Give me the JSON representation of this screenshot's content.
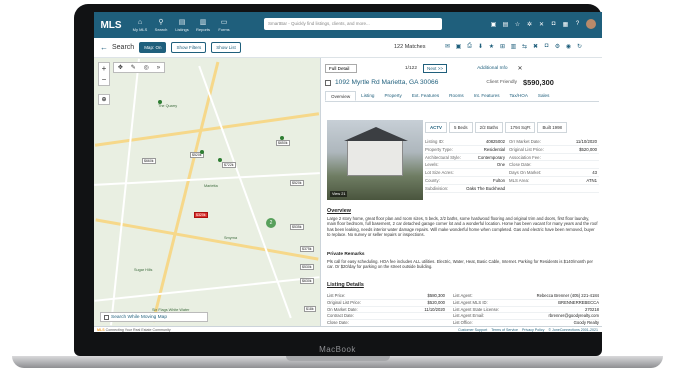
{
  "device": {
    "label": "MacBook"
  },
  "nav": {
    "logo_text": "MLS",
    "items": [
      {
        "label": "My MLS",
        "icon": "home-icon"
      },
      {
        "label": "Search",
        "icon": "search-icon"
      },
      {
        "label": "Listings",
        "icon": "listings-icon"
      },
      {
        "label": "Reports",
        "icon": "reports-icon"
      },
      {
        "label": "Forms",
        "icon": "forms-icon"
      }
    ],
    "smartbar_placeholder": "SmartBar - Quickly find listings, clients, and more..."
  },
  "search": {
    "title": "Search",
    "map_on_label": "Map: On",
    "show_filters_label": "Show Filters",
    "show_list_label": "Show List",
    "matches": "122 Matches"
  },
  "map": {
    "search_while_moving_label": "Search While Moving Map",
    "price_pins": [
      {
        "label": "$660k"
      },
      {
        "label": "$520k"
      },
      {
        "label": "$722k"
      },
      {
        "label": "$650k"
      },
      {
        "label": "$520k"
      },
      {
        "label": "$320k"
      },
      {
        "label": "$535k"
      },
      {
        "label": "$375k"
      },
      {
        "label": "$530k"
      },
      {
        "label": "$630k"
      },
      {
        "label": "$18k"
      }
    ],
    "cluster_label": "2",
    "places": [
      "The Quarry",
      "Marietta",
      "Smyrna",
      "Sugar Hills",
      "Six Flags White Water"
    ]
  },
  "detail": {
    "view_select": "Full Detail",
    "pager": "1/122",
    "next_label": "Next >>",
    "additional_info": "Additional Info",
    "address": "1092 Myrtle Rd Marietta, GA 30066",
    "client_friendly": "Client Friendly",
    "price": "$590,300",
    "tabs": [
      "Overview",
      "Listing",
      "Property",
      "Ext. Features",
      "Rooms",
      "Int. Features",
      "Tax/HOA",
      "Sales"
    ],
    "photo_caption": "View 21",
    "badges": [
      "ACTV",
      "5 Beds",
      "2/2 Baths",
      "1794 SqFt",
      "Built 1998"
    ],
    "facts": [
      {
        "l": "Listing ID:",
        "v": "40825002",
        "l2": "Orr Market Date:",
        "v2": "11/10/2020"
      },
      {
        "l": "Property Type:",
        "v": "Residential",
        "l2": "Original List Price:",
        "v2": "$520,000"
      },
      {
        "l": "Architectural Style:",
        "v": "Contemporary",
        "l2": "Association Fee:",
        "v2": ""
      },
      {
        "l": "Levels:",
        "v": "One",
        "l2": "Close Date:",
        "v2": ""
      },
      {
        "l": "Lot Size Acres:",
        "v": "",
        "l2": "Days On Market:",
        "v2": "43"
      },
      {
        "l": "County:",
        "v": "Fulton",
        "l2": "MLS Area:",
        "v2": "ATN1"
      },
      {
        "l": "Subdivision:",
        "v": "Oaks The Buckhead",
        "l2": "",
        "v2": ""
      }
    ],
    "overview_title": "Overview",
    "overview_text": "Large 2 story home, great floor plan and room sizes, 5 beds, 2/2 baths, some hardwood flooring and original trim and doors, first floor laundry, main floor bedroom, full basement, 2 car detached garage corner lot and a wonderful location. Home has been vacant for many years and the roof has been leaking, needs interior water damage repairs. Will make wonderful home when completed. Gas and electric have been removed, buyer to replace. No survey or seller repairs or inspections.",
    "private_title": "Private Remarks",
    "private_text": "Pls call for easy scheduling. HOA fee includes ALL utilities. Electric, Water, Heat, Basic Cable, Internet. Parking for Residents is $140/month per car. Or $20/day for parking on the street outside building.",
    "listing_title": "Listing Details",
    "listing_rows": [
      {
        "a": "List Price:",
        "b": "$580,300",
        "c": "List Agent:",
        "d": "Rebecca Brenner (405) 221-4184"
      },
      {
        "a": "Original List Price:",
        "b": "$520,000",
        "c": "List Agent MLS ID:",
        "d": "BRENNERREBECCA"
      },
      {
        "a": "On Market Date:",
        "b": "11/10/2020",
        "c": "List Agent State License:",
        "d": "270218"
      },
      {
        "a": "Contract Date:",
        "b": "",
        "c": "List Agent Email:",
        "d": "rbrenner@goodyrealty.com"
      },
      {
        "a": "Close Date:",
        "b": "",
        "c": "List Office:",
        "d": "Goody Realty"
      }
    ]
  },
  "footer": {
    "brand": "MLS",
    "tagline": "Connecting Your Real Estate Community",
    "links": [
      "Customer Support",
      "Terms of Service",
      "Privacy Policy",
      "© JoneConnections 2001-2021"
    ]
  }
}
